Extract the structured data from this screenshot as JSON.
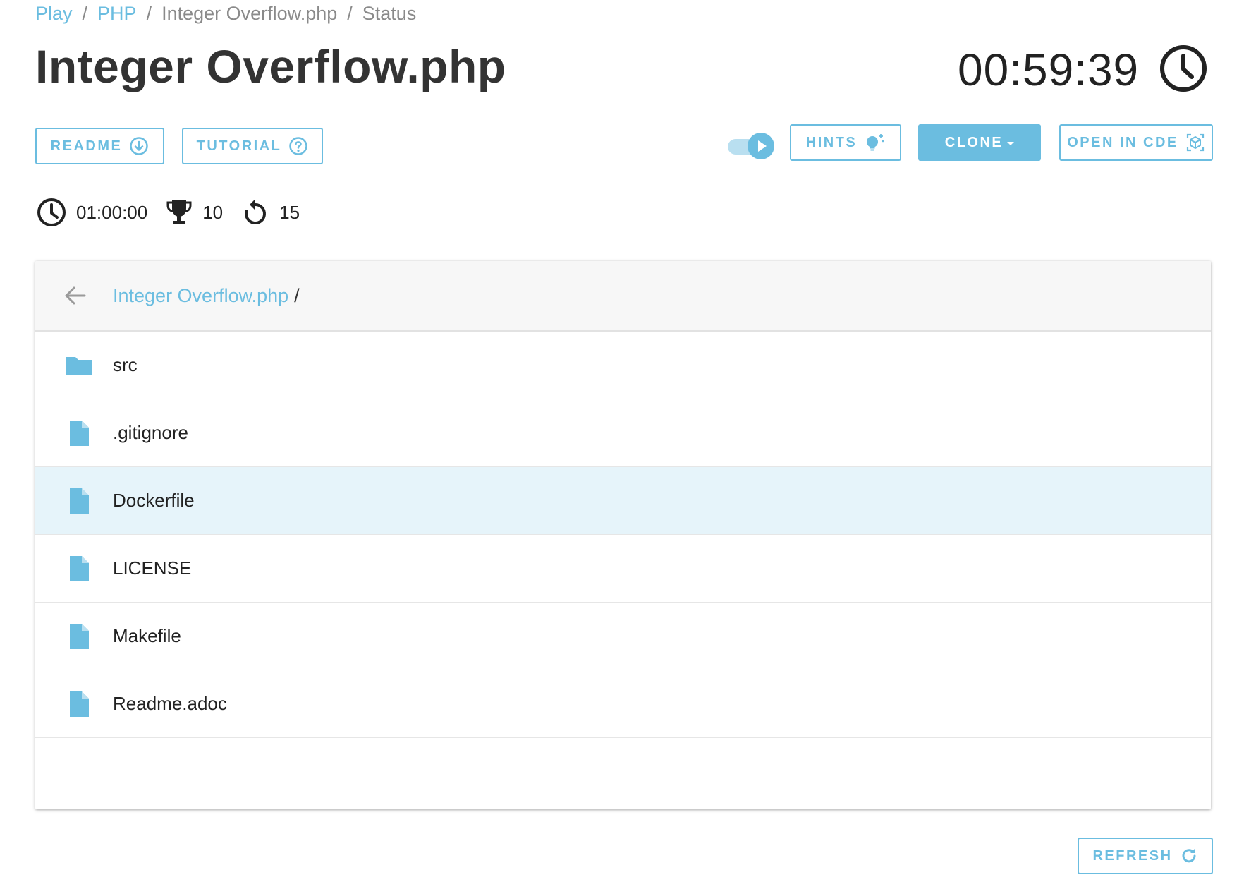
{
  "breadcrumb": {
    "items": [
      {
        "label": "Play",
        "link": true
      },
      {
        "label": "PHP",
        "link": true
      },
      {
        "label": "Integer Overflow.php",
        "link": false
      },
      {
        "label": "Status",
        "link": false
      }
    ],
    "separator": "/"
  },
  "page_title": "Integer Overflow.php",
  "countdown": "00:59:39",
  "buttons": {
    "readme": "README",
    "tutorial": "TUTORIAL",
    "hints": "HINTS",
    "clone": "CLONE",
    "open_in_cde": "OPEN IN CDE",
    "refresh": "REFRESH"
  },
  "toggle": {
    "on": true
  },
  "stats": {
    "time_limit": "01:00:00",
    "points": "10",
    "attempts": "15"
  },
  "browser": {
    "path": "Integer Overflow.php",
    "path_separator": "/",
    "entries": [
      {
        "name": "src",
        "type": "folder",
        "selected": false
      },
      {
        "name": ".gitignore",
        "type": "file",
        "selected": false
      },
      {
        "name": "Dockerfile",
        "type": "file",
        "selected": true
      },
      {
        "name": "LICENSE",
        "type": "file",
        "selected": false
      },
      {
        "name": "Makefile",
        "type": "file",
        "selected": false
      },
      {
        "name": "Readme.adoc",
        "type": "file",
        "selected": false
      }
    ]
  },
  "colors": {
    "accent": "#6bbde0",
    "selected_row": "#e6f4fa",
    "text": "#222222"
  }
}
